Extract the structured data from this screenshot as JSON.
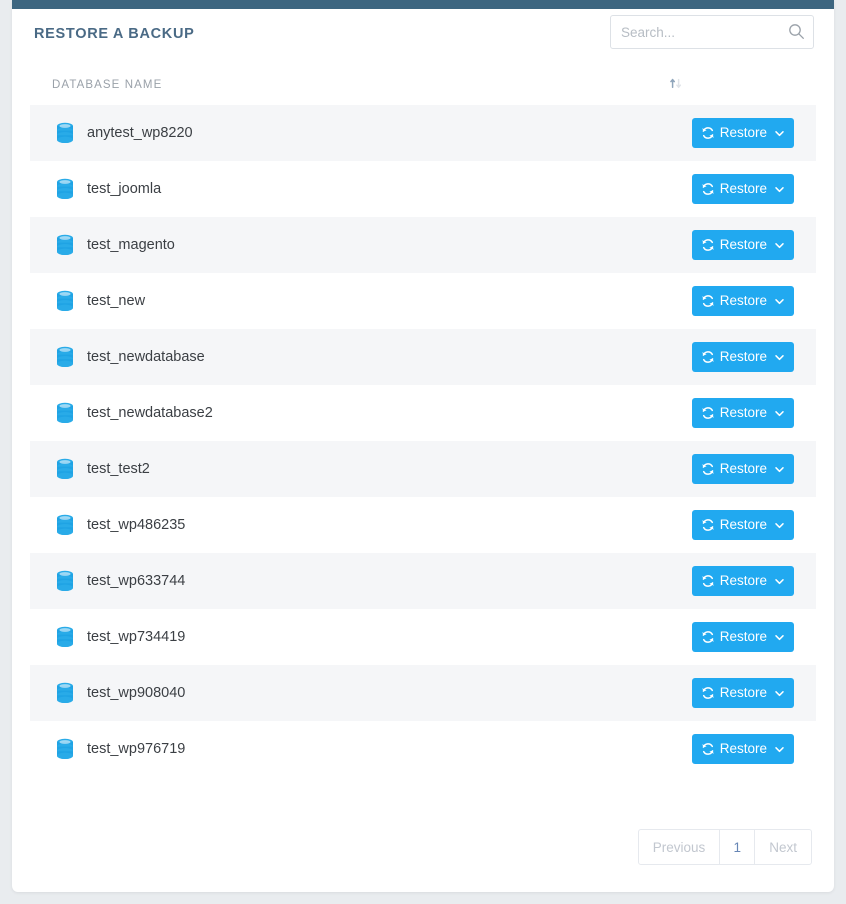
{
  "theme": {
    "topbar_color": "#3d6680",
    "accent_color": "#21a9f0",
    "title_color": "#4a6a85",
    "page_background": "#e9ecef",
    "row_alt_background": "#f5f6f8"
  },
  "header": {
    "title": "RESTORE A BACKUP",
    "search": {
      "placeholder": "Search...",
      "value": "",
      "icon": "search-icon"
    }
  },
  "table": {
    "columns": [
      {
        "label": "DATABASE NAME",
        "sortable": true,
        "sort_icon": "sort-updown-icon"
      }
    ],
    "row_action": {
      "label": "Restore",
      "icon": "restore-refresh-icon",
      "caret_icon": "chevron-down-icon"
    },
    "row_icon": "database-icon",
    "rows": [
      {
        "name": "anytest_wp8220"
      },
      {
        "name": "test_joomla"
      },
      {
        "name": "test_magento"
      },
      {
        "name": "test_new"
      },
      {
        "name": "test_newdatabase"
      },
      {
        "name": "test_newdatabase2"
      },
      {
        "name": "test_test2"
      },
      {
        "name": "test_wp486235"
      },
      {
        "name": "test_wp633744"
      },
      {
        "name": "test_wp734419"
      },
      {
        "name": "test_wp908040"
      },
      {
        "name": "test_wp976719"
      }
    ]
  },
  "pagination": {
    "previous_label": "Previous",
    "next_label": "Next",
    "pages": [
      "1"
    ],
    "current_page": "1"
  }
}
